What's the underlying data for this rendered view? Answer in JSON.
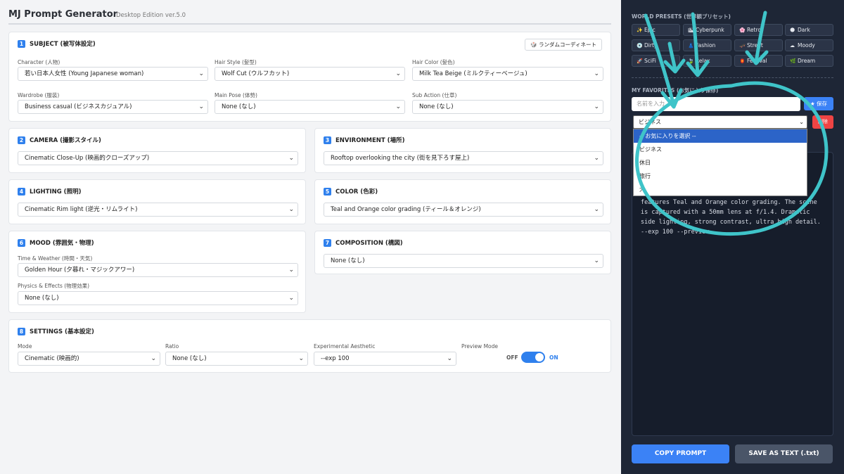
{
  "header": {
    "title": "MJ Prompt Generator",
    "version": "Desktop Edition ver.5.0"
  },
  "subject": {
    "num": "1",
    "title": "SUBJECT (被写体設定)",
    "random_btn": "ランダムコーディネート",
    "fields": [
      {
        "label": "Character (人物)",
        "value": "若い日本人女性 (Young Japanese woman)"
      },
      {
        "label": "Hair Style (髪型)",
        "value": "Wolf Cut (ウルフカット)"
      },
      {
        "label": "Hair Color (髪色)",
        "value": "Milk Tea Beige (ミルクティーベージュ)"
      },
      {
        "label": "Wardrobe (服装)",
        "value": "Business casual (ビジネスカジュアル)"
      },
      {
        "label": "Main Pose (体勢)",
        "value": "None (なし)"
      },
      {
        "label": "Sub Action (仕草)",
        "value": "None (なし)"
      }
    ]
  },
  "camera": {
    "num": "2",
    "title": "CAMERA (撮影スタイル)",
    "value": "Cinematic Close-Up (映画的クローズアップ)"
  },
  "environment": {
    "num": "3",
    "title": "ENVIRONMENT (場所)",
    "value": "Rooftop overlooking the city (街を見下ろす屋上)"
  },
  "lighting": {
    "num": "4",
    "title": "LIGHTING (照明)",
    "value": "Cinematic Rim light (逆光・リムライト)"
  },
  "color": {
    "num": "5",
    "title": "COLOR (色彩)",
    "value": "Teal and Orange color grading (ティール＆オレンジ)"
  },
  "mood": {
    "num": "6",
    "title": "MOOD (雰囲気・物理)",
    "time_label": "Time & Weather (時間・天気)",
    "time_value": "Golden Hour (夕暮れ・マジックアワー)",
    "phys_label": "Physics & Effects (物理効果)",
    "phys_value": "None (なし)"
  },
  "composition": {
    "num": "7",
    "title": "COMPOSITION (構図)",
    "value": "None (なし)"
  },
  "settings": {
    "num": "8",
    "title": "SETTINGS (基本設定)",
    "mode_label": "Mode",
    "mode_value": "Cinematic (映画的)",
    "ratio_label": "Ratio",
    "ratio_value": "None (なし)",
    "exp_label": "Experimental Aesthetic",
    "exp_value": "--exp 100",
    "preview_label": "Preview Mode",
    "off": "OFF",
    "on": "ON",
    "preview_on": true
  },
  "sidebar": {
    "presets_title": "WORLD PRESETS (世界観プリセット)",
    "presets": [
      {
        "label": "Epic",
        "icon": "✨"
      },
      {
        "label": "Cyberpunk",
        "icon": "🏙"
      },
      {
        "label": "Retro",
        "icon": "🌸"
      },
      {
        "label": "Dark",
        "icon": "🌑"
      },
      {
        "label": "Dirty",
        "icon": "💿"
      },
      {
        "label": "Fashion",
        "icon": "👗"
      },
      {
        "label": "Street",
        "icon": "🛹"
      },
      {
        "label": "Moody",
        "icon": "☁"
      },
      {
        "label": "SciFi",
        "icon": "🚀"
      },
      {
        "label": "Relax",
        "icon": "🍃"
      },
      {
        "label": "Festival",
        "icon": "🏮"
      },
      {
        "label": "Dream",
        "icon": "🌿"
      }
    ],
    "favorites_title": "MY FAVORITES (お気に入り保存)",
    "fav_placeholder": "名前を入力",
    "save_btn": "★ 保存",
    "fav_selected": "ビジネス",
    "delete_btn": "削除",
    "fav_options": [
      "-- お気に入りを選択 --",
      "ビジネス",
      "休日",
      "旅行",
      "犬"
    ],
    "output": "ilk\n\nene\nlighting is cinematic rim light. Color grading\nfeatures Teal and Orange color grading. The scene\nis captured with a 50mm lens at f/1.4. Dramatic\nside lighting, strong contrast, ultra high detail.\n--exp 100 --preview",
    "copy_btn": "COPY PROMPT",
    "save_txt_btn": "SAVE AS TEXT (.txt)"
  },
  "annotation_color": "#3fc4c9"
}
